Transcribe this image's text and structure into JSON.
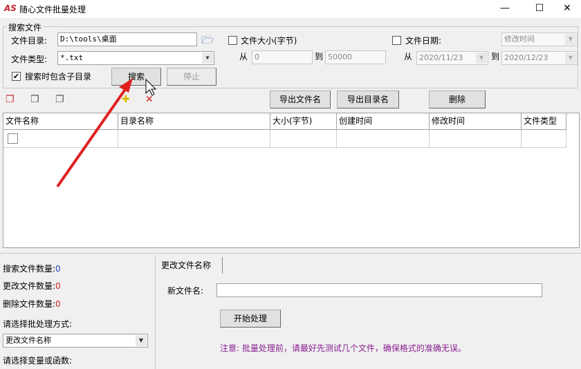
{
  "window": {
    "logo": "AS",
    "title": "随心文件批量处理",
    "minimize": "—",
    "maximize": "☐",
    "close": "✕"
  },
  "search": {
    "group_label": "搜索文件",
    "dir_label": "文件目录:",
    "dir_value": "D:\\tools\\桌面",
    "type_label": "文件类型:",
    "type_value": "*.txt",
    "subdir_label": "搜索时包含子目录",
    "subdir_checked": true,
    "search_button": "搜索",
    "stop_button": "停止",
    "size_label": "文件大小(字节)",
    "size_from_label": "从",
    "size_from": "0",
    "size_to_label": "到",
    "size_to": "50000",
    "date_label": "文件日期:",
    "date_type": "修改时间",
    "date_from_label": "从",
    "date_from": "2020/11/23",
    "date_to_label": "到",
    "date_to": "2020/12/23"
  },
  "toolbar": {
    "export_files": "导出文件名",
    "export_dirs": "导出目录名",
    "delete": "删除"
  },
  "table": {
    "columns": [
      "文件名称",
      "目录名称",
      "大小(字节)",
      "创建时间",
      "修改时间",
      "文件类型"
    ]
  },
  "stats": {
    "search_label": "搜索文件数量:",
    "search_count": "0",
    "rename_label": "更改文件数量:",
    "rename_count": "0",
    "delete_label": "删除文件数量:",
    "delete_count": "0",
    "mode_label": "请选择批处理方式:",
    "mode_value": "更改文件名称",
    "var_label": "请选择变量或函数:"
  },
  "rename": {
    "tab": "更改文件名称",
    "new_name_label": "新文件名:",
    "new_name_value": "",
    "start_button": "开始处理",
    "note": "注意: 批量处理前，请最好先测试几个文件，确保格式的准确无误。"
  }
}
